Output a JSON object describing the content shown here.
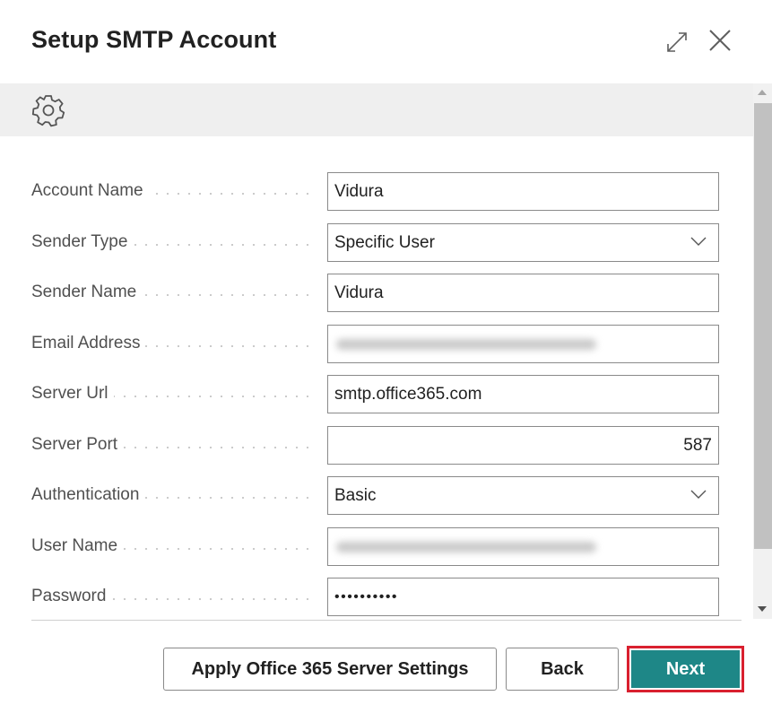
{
  "dialog": {
    "title": "Setup SMTP Account",
    "icons": {
      "expand": "expand-diagonal-arrows-icon",
      "close": "close-x-icon",
      "settings": "gear-icon"
    }
  },
  "form": {
    "fields": [
      {
        "label": "Account Name",
        "type": "text",
        "value": "Vidura"
      },
      {
        "label": "Sender Type",
        "type": "select",
        "value": "Specific User"
      },
      {
        "label": "Sender Name",
        "type": "text",
        "value": "Vidura"
      },
      {
        "label": "Email Address",
        "type": "text",
        "value": "[redacted - blurred]"
      },
      {
        "label": "Server Url",
        "type": "text",
        "value": "smtp.office365.com"
      },
      {
        "label": "Server Port",
        "type": "number",
        "value": "587"
      },
      {
        "label": "Authentication",
        "type": "select",
        "value": "Basic"
      },
      {
        "label": "User Name",
        "type": "text",
        "value": "[redacted - blurred]"
      },
      {
        "label": "Password",
        "type": "password",
        "value": "••••••••••"
      }
    ]
  },
  "footer": {
    "apply_label": "Apply Office 365 Server Settings",
    "back_label": "Back",
    "next_label": "Next"
  },
  "colors": {
    "primary_button": "#1e8787",
    "highlight_border": "#d9202f",
    "action_bar_bg": "#efefef"
  }
}
